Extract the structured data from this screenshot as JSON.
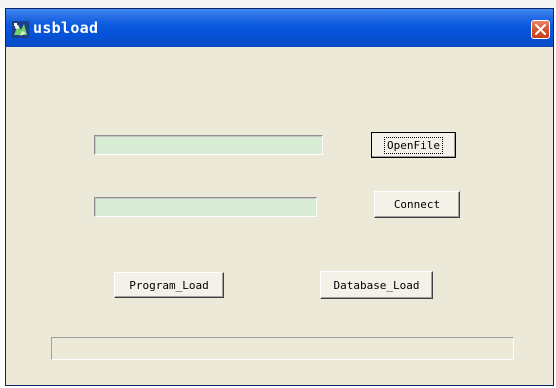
{
  "window": {
    "title": "usbload",
    "icon": "usbload-app-icon",
    "close_icon": "close-icon",
    "titlebar_color": "#0552d6",
    "close_color": "#d7562f"
  },
  "form": {
    "file_path_value": "",
    "connection_value": "",
    "open_file_label": "OpenFile",
    "connect_label": "Connect",
    "program_load_label": "Program_Load",
    "database_load_label": "Database_Load",
    "progress": 0,
    "textbox_color": "#d8ecd6"
  }
}
